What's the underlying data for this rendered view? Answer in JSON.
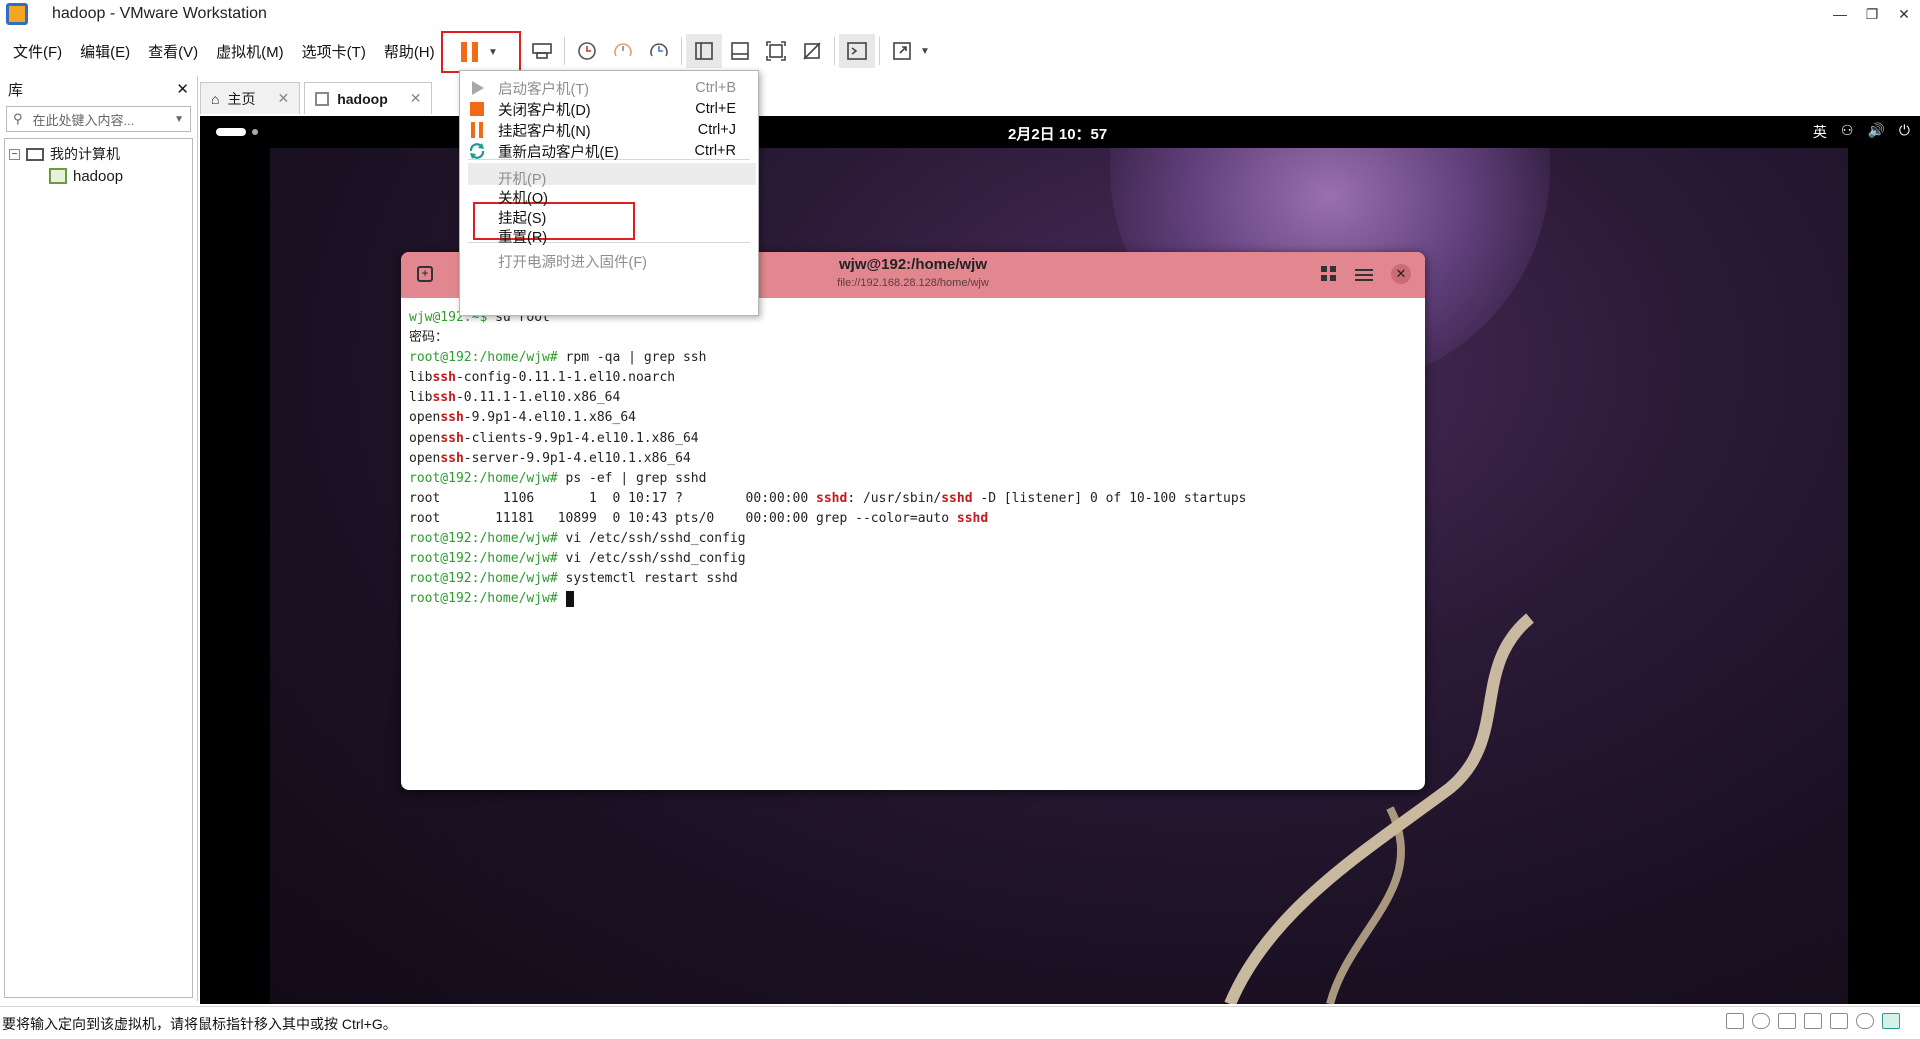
{
  "window": {
    "title": "hadoop - VMware Workstation",
    "controls": [
      "—",
      "❐",
      "✕"
    ]
  },
  "menu": {
    "items": [
      "文件(F)",
      "编辑(E)",
      "查看(V)",
      "虚拟机(M)",
      "选项卡(T)",
      "帮助(H)"
    ]
  },
  "library": {
    "title": "库",
    "close": "✕",
    "search_placeholder": "在此处键入内容...",
    "tree": {
      "root": "我的计算机",
      "child": "hadoop",
      "expander": "−"
    }
  },
  "tabs": [
    {
      "label": "主页",
      "close": "✕"
    },
    {
      "label": "hadoop",
      "close": "✕"
    }
  ],
  "guest": {
    "clock": "2月2日 10：57",
    "tray": {
      "ime": "英",
      "network": "⚇",
      "volume": "🔊",
      "power": "⏻"
    }
  },
  "terminal": {
    "title": "wjw@192:/home/wjw",
    "subtitle": "file://192.168.28.128/home/wjw",
    "lines": [
      [
        {
          "t": "wjw@192:~$ ",
          "c": "pr"
        },
        {
          "t": "su root"
        }
      ],
      [
        {
          "t": "密码："
        }
      ],
      [
        {
          "t": "root@192:/home/wjw# ",
          "c": "pr"
        },
        {
          "t": "rpm -qa | grep ssh"
        }
      ],
      [
        {
          "t": "lib"
        },
        {
          "t": "ssh",
          "c": "hl"
        },
        {
          "t": "-config-0.11.1-1.el10.noarch"
        }
      ],
      [
        {
          "t": "lib"
        },
        {
          "t": "ssh",
          "c": "hl"
        },
        {
          "t": "-0.11.1-1.el10.x86_64"
        }
      ],
      [
        {
          "t": "open"
        },
        {
          "t": "ssh",
          "c": "hl"
        },
        {
          "t": "-9.9p1-4.el10.1.x86_64"
        }
      ],
      [
        {
          "t": "open"
        },
        {
          "t": "ssh",
          "c": "hl"
        },
        {
          "t": "-clients-9.9p1-4.el10.1.x86_64"
        }
      ],
      [
        {
          "t": "open"
        },
        {
          "t": "ssh",
          "c": "hl"
        },
        {
          "t": "-server-9.9p1-4.el10.1.x86_64"
        }
      ],
      [
        {
          "t": "root@192:/home/wjw# ",
          "c": "pr"
        },
        {
          "t": "ps -ef | grep sshd"
        }
      ],
      [
        {
          "t": "root        1106       1  0 10:17 ?        00:00:00 "
        },
        {
          "t": "sshd",
          "c": "hl"
        },
        {
          "t": ": /usr/sbin/"
        },
        {
          "t": "sshd",
          "c": "hl"
        },
        {
          "t": " -D [listener] 0 of 10-100 startups"
        }
      ],
      [
        {
          "t": "root       11181   10899  0 10:43 pts/0    00:00:00 grep --color=auto "
        },
        {
          "t": "sshd",
          "c": "hl"
        }
      ],
      [
        {
          "t": "root@192:/home/wjw# ",
          "c": "pr"
        },
        {
          "t": "vi /etc/ssh/sshd_config"
        }
      ],
      [
        {
          "t": "root@192:/home/wjw# ",
          "c": "pr"
        },
        {
          "t": "vi /etc/ssh/sshd_config"
        }
      ],
      [
        {
          "t": "root@192:/home/wjw# ",
          "c": "pr"
        },
        {
          "t": "systemctl restart sshd"
        }
      ],
      [
        {
          "t": "root@192:/home/wjw# ",
          "c": "pr"
        }
      ]
    ]
  },
  "power_menu": {
    "items": [
      {
        "label": "启动客户机(T)",
        "shortcut": "Ctrl+B",
        "disabled": true,
        "icon": "play-icon"
      },
      {
        "label": "关闭客户机(D)",
        "shortcut": "Ctrl+E",
        "disabled": false,
        "icon": "stop-icon"
      },
      {
        "label": "挂起客户机(N)",
        "shortcut": "Ctrl+J",
        "disabled": false,
        "icon": "pause-icon"
      },
      {
        "label": "重新启动客户机(E)",
        "shortcut": "Ctrl+R",
        "disabled": false,
        "icon": "restart-icon"
      },
      {
        "label": "开机(P)",
        "shortcut": "",
        "disabled": true,
        "icon": ""
      },
      {
        "label": "关机(O)",
        "shortcut": "",
        "disabled": false,
        "icon": ""
      },
      {
        "label": "挂起(S)",
        "shortcut": "",
        "disabled": false,
        "icon": ""
      },
      {
        "label": "重置(R)",
        "shortcut": "",
        "disabled": false,
        "icon": ""
      },
      {
        "label": "打开电源时进入固件(F)",
        "shortcut": "",
        "disabled": true,
        "icon": ""
      }
    ]
  },
  "status": {
    "text": "要将输入定向到该虚拟机，请将鼠标指针移入其中或按 Ctrl+G。"
  },
  "colors": {
    "pause_orange": "#f06a18",
    "highlight_red": "#e02020",
    "terminal_header": "#e2878f",
    "prompt_green": "#2d9b2d",
    "match_red": "#c41a1a"
  }
}
